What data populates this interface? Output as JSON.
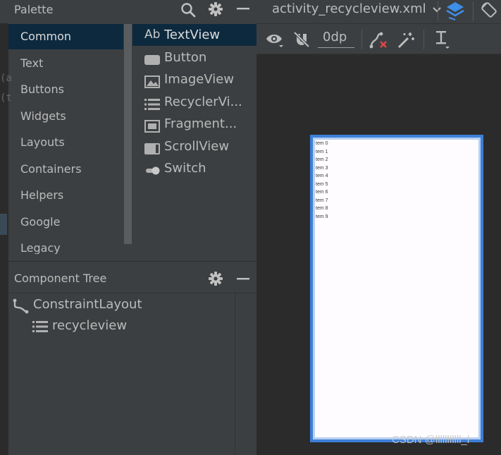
{
  "palette": {
    "title": "Palette",
    "categories": [
      "Common",
      "Text",
      "Buttons",
      "Widgets",
      "Layouts",
      "Containers",
      "Helpers",
      "Google",
      "Legacy"
    ],
    "items": [
      {
        "label": "TextView",
        "icon": "ab-text-icon",
        "icon_text": "Ab"
      },
      {
        "label": "Button",
        "icon": "button-icon"
      },
      {
        "label": "ImageView",
        "icon": "image-icon"
      },
      {
        "label": "RecyclerVi...",
        "icon": "list-icon"
      },
      {
        "label": "Fragment...",
        "icon": "fragment-icon"
      },
      {
        "label": "ScrollView",
        "icon": "scrollview-icon"
      },
      {
        "label": "Switch",
        "icon": "switch-icon"
      }
    ]
  },
  "component_tree": {
    "title": "Component Tree",
    "nodes": [
      "ConstraintLayout",
      "recycleview"
    ]
  },
  "editor": {
    "file_tab": "activity_recycleview.xml",
    "default_margin": "0dp"
  },
  "preview": {
    "items": [
      "tem 0",
      "tem 1",
      "tem 2",
      "tem 3",
      "tem 4",
      "tem 5",
      "tem 6",
      "tem 7",
      "tem 8",
      "tem 9"
    ]
  },
  "watermark": "CSDN @lllllllllll_l",
  "colors": {
    "panel_bg": "#3c3f41",
    "editor_bg": "#2b2b2b",
    "selection": "#0d293e",
    "device_border": "#3d7fd9",
    "accent_blue": "#3d8fe8"
  }
}
